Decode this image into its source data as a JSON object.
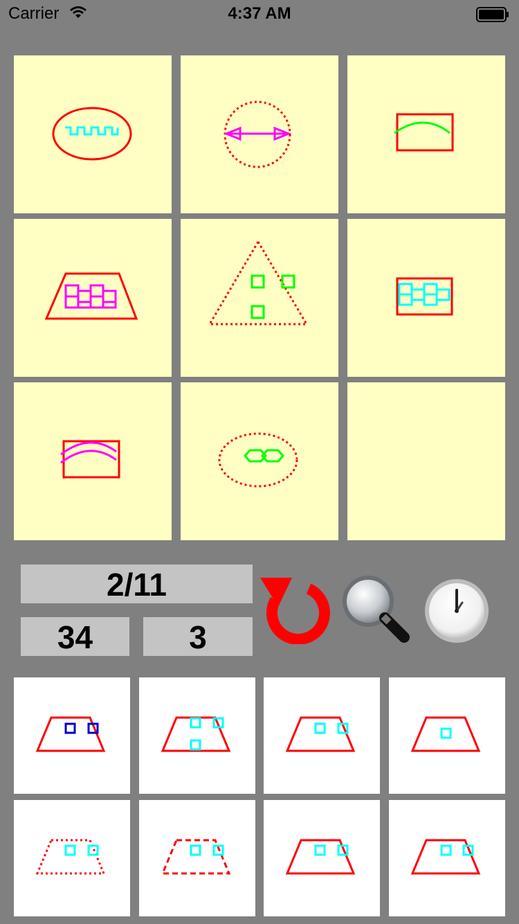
{
  "status_bar": {
    "carrier": "Carrier",
    "time": "4:37 AM"
  },
  "counters": {
    "progress": "2/11",
    "score": "34",
    "attempts": "3"
  },
  "colors": {
    "outline": "#ff0000",
    "cyan": "#00ffff",
    "magenta": "#ff00ff",
    "green": "#00ff00",
    "blue": "#0000cc",
    "tile": "#ffffc4"
  },
  "icons": {
    "reset": "reset-icon",
    "hint": "magnifier-icon",
    "timer": "clock-icon"
  }
}
